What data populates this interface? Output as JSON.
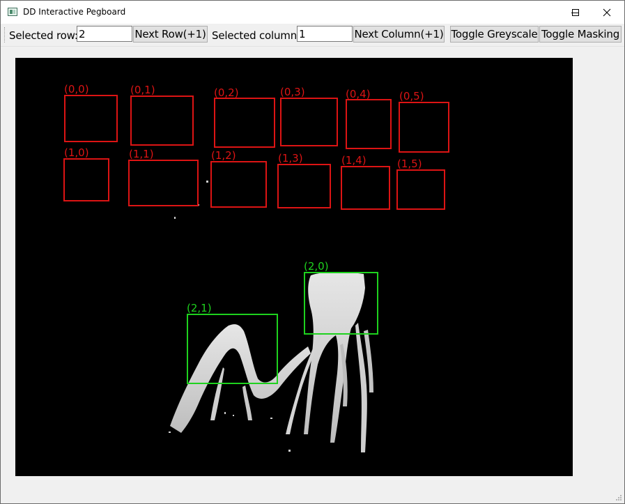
{
  "window": {
    "title": "DD Interactive Pegboard"
  },
  "toolbar": {
    "row_label": "Selected row:",
    "row_value": "2",
    "next_row": "Next Row(+1)",
    "col_label": "Selected column:",
    "col_value": "1",
    "next_col": "Next Column(+1)",
    "greyscale": "Toggle Greyscale",
    "masking": "Toggle Masking"
  },
  "pegboard": {
    "selected_row": 2,
    "selected_column": 1,
    "highlight_color": "#1ed21e",
    "default_color": "#dd1414",
    "cells": [
      {
        "label": "(0,0)",
        "highlighted": false
      },
      {
        "label": "(0,1)",
        "highlighted": false
      },
      {
        "label": "(0,2)",
        "highlighted": false
      },
      {
        "label": "(0,3)",
        "highlighted": false
      },
      {
        "label": "(0,4)",
        "highlighted": false
      },
      {
        "label": "(0,5)",
        "highlighted": false
      },
      {
        "label": "(1,0)",
        "highlighted": false
      },
      {
        "label": "(1,1)",
        "highlighted": false
      },
      {
        "label": "(1,2)",
        "highlighted": false
      },
      {
        "label": "(1,3)",
        "highlighted": false
      },
      {
        "label": "(1,4)",
        "highlighted": false
      },
      {
        "label": "(1,5)",
        "highlighted": false
      },
      {
        "label": "(2,0)",
        "highlighted": true
      },
      {
        "label": "(2,1)",
        "highlighted": true
      }
    ]
  }
}
